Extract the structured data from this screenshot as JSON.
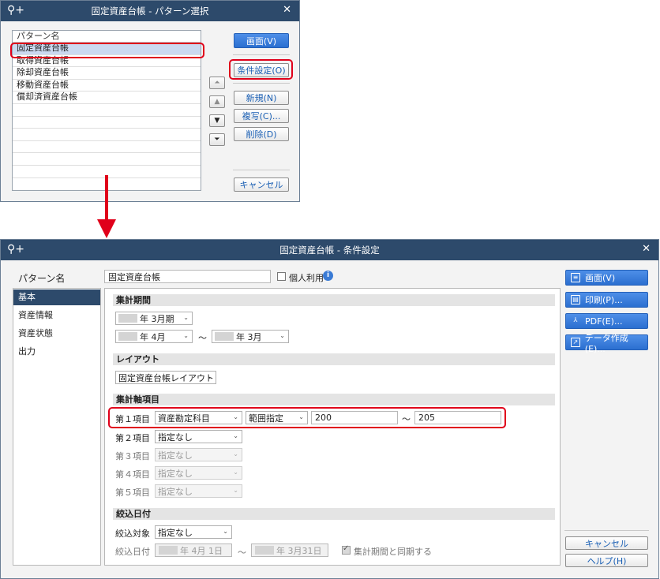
{
  "pattern_dialog": {
    "title": "固定資産台帳 - パターン選択",
    "list_header": "パターン名",
    "items": [
      "固定資産台帳",
      "取得資産台帳",
      "除却資産台帳",
      "移動資産台帳",
      "償却済資産台帳"
    ],
    "buttons": {
      "screen": "画面(V)",
      "conditions": "条件設定(O)",
      "new": "新規(N)",
      "copy": "複写(C)...",
      "delete": "削除(D)",
      "cancel": "キャンセル"
    },
    "arrows": {
      "top": "⏶",
      "up": "▲",
      "down": "▼",
      "bottom": "⏷"
    }
  },
  "condition_dialog": {
    "title": "固定資産台帳 - 条件設定",
    "pattern_label": "パターン名",
    "pattern_value": "固定資産台帳",
    "personal_use": "個人利用",
    "nav": [
      "基本",
      "資産情報",
      "資産状態",
      "出力"
    ],
    "sections": {
      "period": "集計期間",
      "layout": "レイアウト",
      "axis": "集計軸項目",
      "filter_date": "絞込日付"
    },
    "period": {
      "year_suffix": "年",
      "period_value": "3月期",
      "from_month": "4月",
      "to_month": "3月",
      "tilde": "〜"
    },
    "layout_value": "固定資産台帳レイアウト",
    "axis_rows": [
      {
        "label": "第１項目",
        "item": "資産勘定科目",
        "mode": "範囲指定",
        "from": "200",
        "to": "205"
      },
      {
        "label": "第２項目",
        "item": "指定なし"
      },
      {
        "label": "第３項目",
        "item": "指定なし"
      },
      {
        "label": "第４項目",
        "item": "指定なし"
      },
      {
        "label": "第５項目",
        "item": "指定なし"
      }
    ],
    "filter": {
      "target_label": "絞込対象",
      "target_value": "指定なし",
      "date_label": "絞込日付",
      "from_date": "年 4月 1日",
      "to_date": "年 3月31日",
      "sync_label": "集計期間と同期する"
    },
    "buttons": {
      "screen": "画面(V)",
      "print": "印刷(P)...",
      "pdf": "PDF(E)...",
      "data": "データ作成(E)...",
      "cancel": "キャンセル",
      "help": "ヘルプ(H)"
    }
  },
  "colors": {
    "titlebar": "#2d4a6b",
    "highlight": "#e0001a",
    "primary": "#2b6fd0",
    "arrow": "#e0001a"
  }
}
